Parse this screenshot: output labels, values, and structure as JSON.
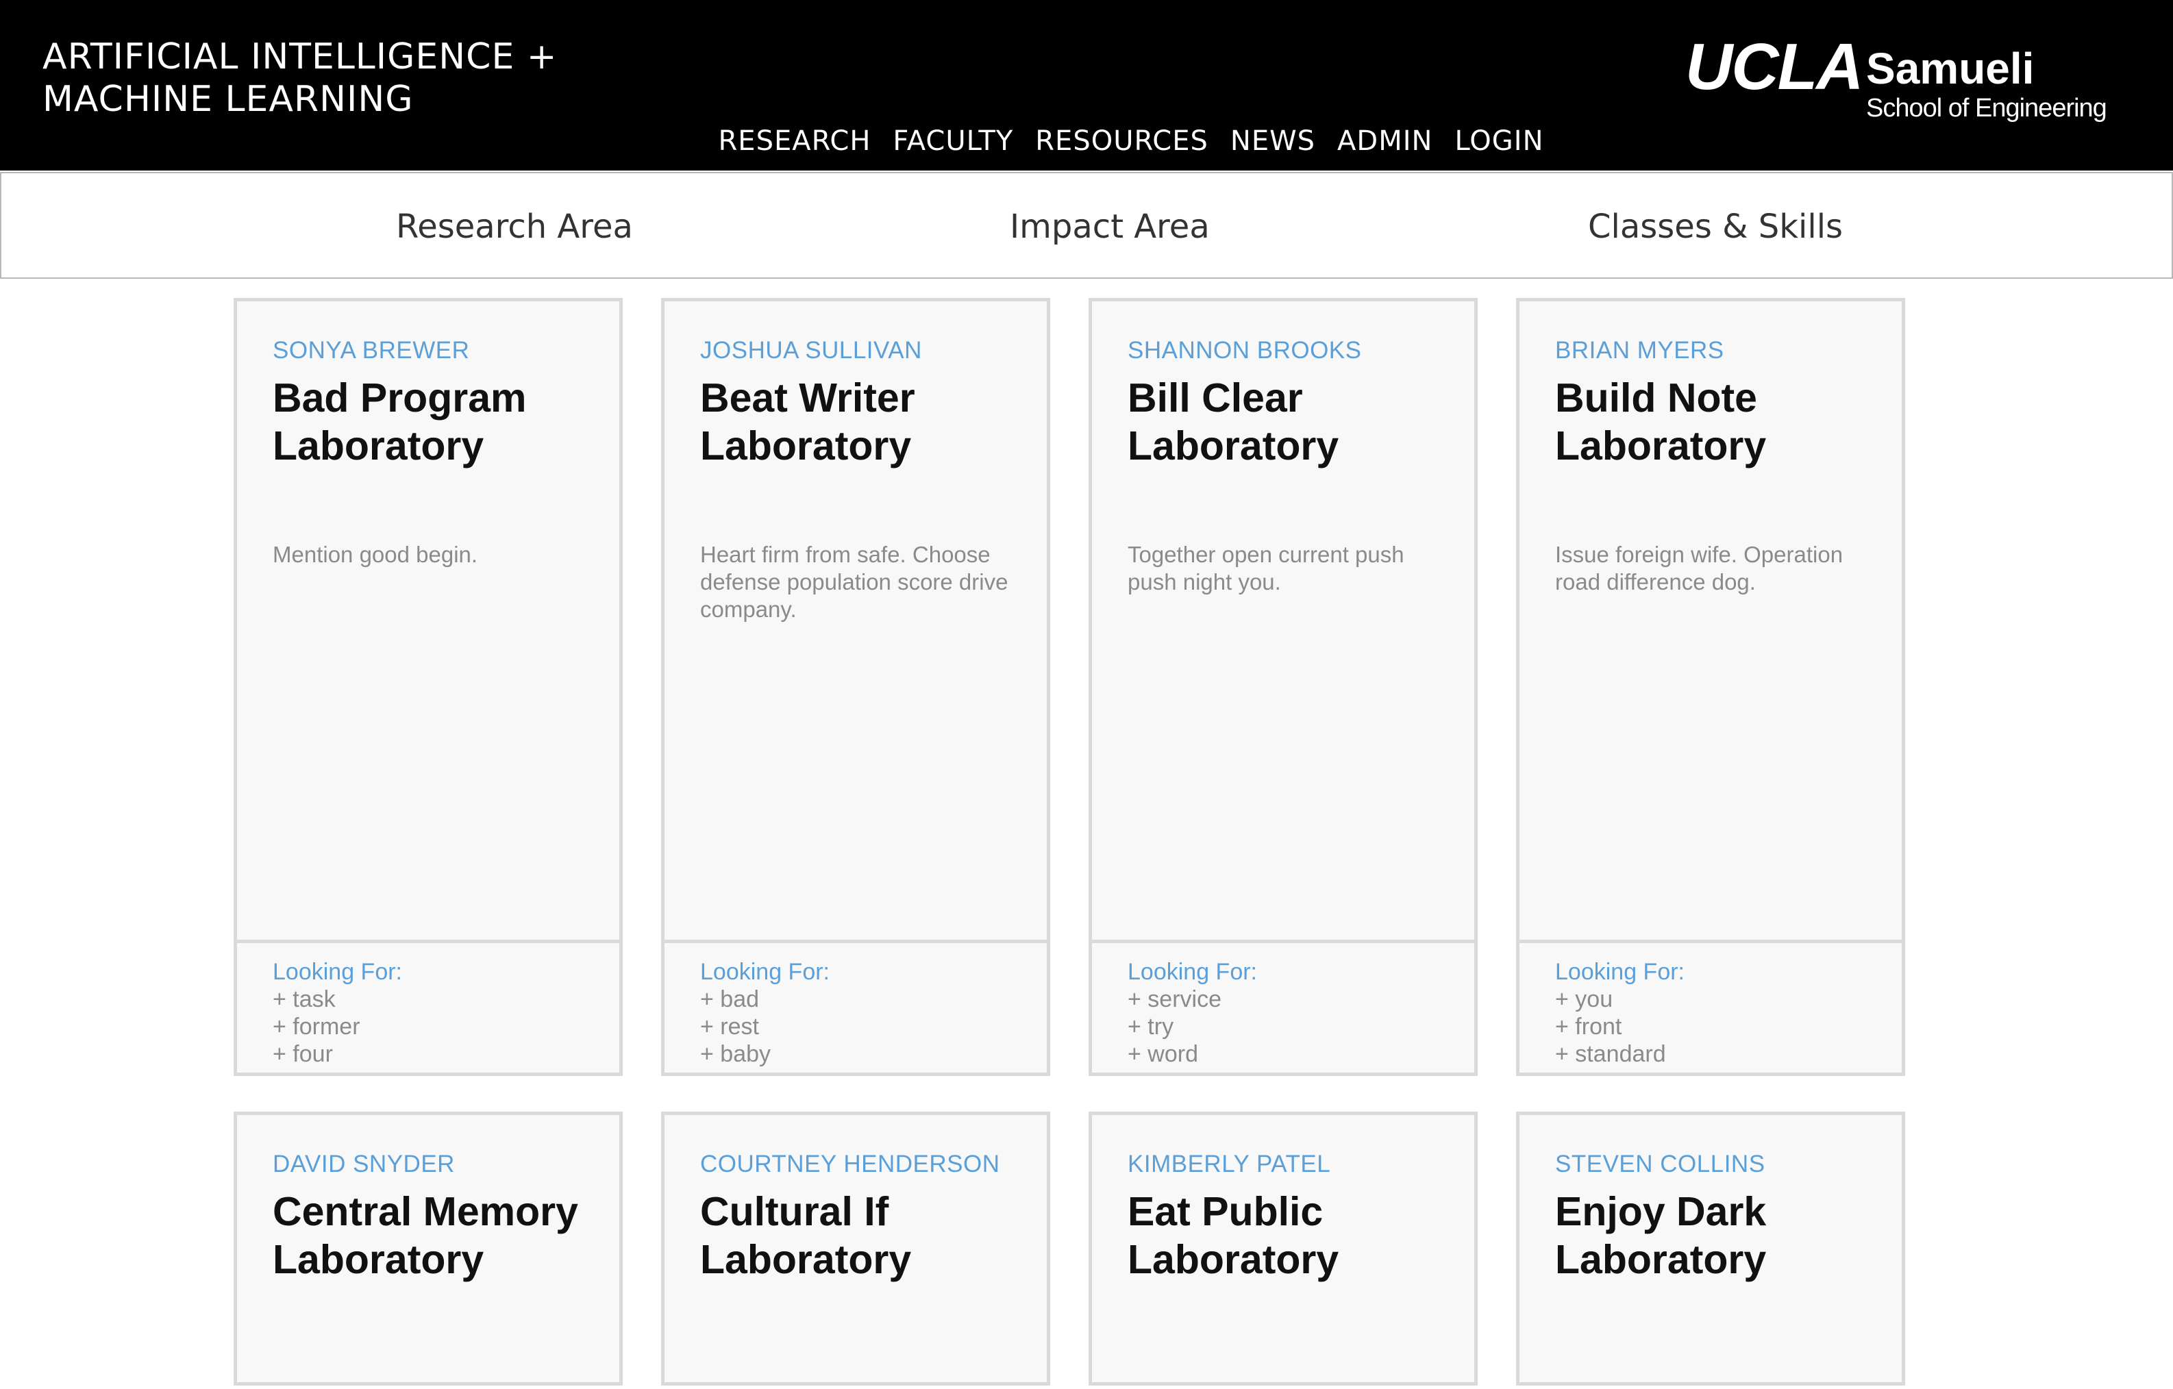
{
  "header": {
    "title_line1": "ARTIFICIAL INTELLIGENCE +",
    "title_line2": "MACHINE LEARNING",
    "nav": [
      "RESEARCH",
      "FACULTY",
      "RESOURCES",
      "NEWS",
      "ADMIN",
      "LOGIN"
    ],
    "brand": {
      "ucla": "UCLA",
      "samueli": "Samueli",
      "school": "School of Engineering"
    }
  },
  "filters": [
    "Research Area",
    "Impact Area",
    "Classes & Skills"
  ],
  "looking_for_label": "Looking For:",
  "cards": [
    {
      "author": "SONYA BREWER",
      "title": "Bad Program Laboratory",
      "description": "Mention good begin.",
      "looking_for": [
        "+ task",
        "+ former",
        "+ four"
      ]
    },
    {
      "author": "JOSHUA SULLIVAN",
      "title": "Beat Writer Laboratory",
      "description": "Heart firm from safe. Choose defense population score drive company.",
      "looking_for": [
        "+ bad",
        "+ rest",
        "+ baby"
      ]
    },
    {
      "author": "SHANNON BROOKS",
      "title": "Bill Clear Laboratory",
      "description": "Together open current push push night you.",
      "looking_for": [
        "+ service",
        "+ try",
        "+ word"
      ]
    },
    {
      "author": "BRIAN MYERS",
      "title": "Build Note Laboratory",
      "description": "Issue foreign wife. Operation road difference dog.",
      "looking_for": [
        "+ you",
        "+ front",
        "+ standard"
      ]
    },
    {
      "author": "DAVID SNYDER",
      "title": "Central Memory Laboratory"
    },
    {
      "author": "COURTNEY HENDERSON",
      "title": "Cultural If Laboratory"
    },
    {
      "author": "KIMBERLY PATEL",
      "title": "Eat Public Laboratory"
    },
    {
      "author": "STEVEN COLLINS",
      "title": "Enjoy Dark Laboratory"
    }
  ],
  "colors": {
    "header_bg": "#000000",
    "accent_blue": "#5a9fd8",
    "card_bg": "#f8f8f8",
    "card_border": "#d9d9d9"
  }
}
